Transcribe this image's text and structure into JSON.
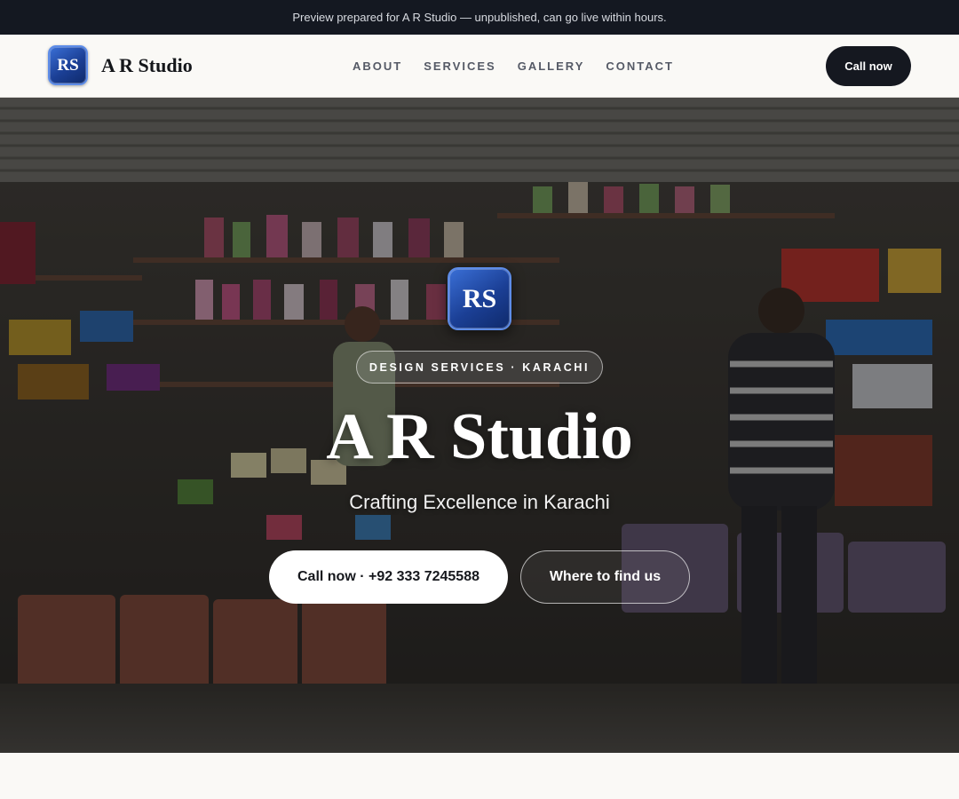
{
  "preview_banner": "Preview prepared for A R Studio — unpublished, can go live within hours.",
  "header": {
    "logo_initials": "RS",
    "brand_name": "A R Studio",
    "nav": [
      {
        "label": "ABOUT"
      },
      {
        "label": "SERVICES"
      },
      {
        "label": "GALLERY"
      },
      {
        "label": "CONTACT"
      }
    ],
    "cta_label": "Call now"
  },
  "hero": {
    "logo_initials": "RS",
    "tagline": "DESIGN SERVICES · KARACHI",
    "title": "A R Studio",
    "subtitle": "Crafting Excellence in Karachi",
    "primary_button": "Call now · +92 333 7245588",
    "secondary_button": "Where to find us",
    "background_image": "shop-storefront-photo"
  },
  "colors": {
    "preview_bar": "#141821",
    "brand_blue": "#1b3f95",
    "dark_button": "#151820",
    "page_bg": "#faf9f6"
  }
}
